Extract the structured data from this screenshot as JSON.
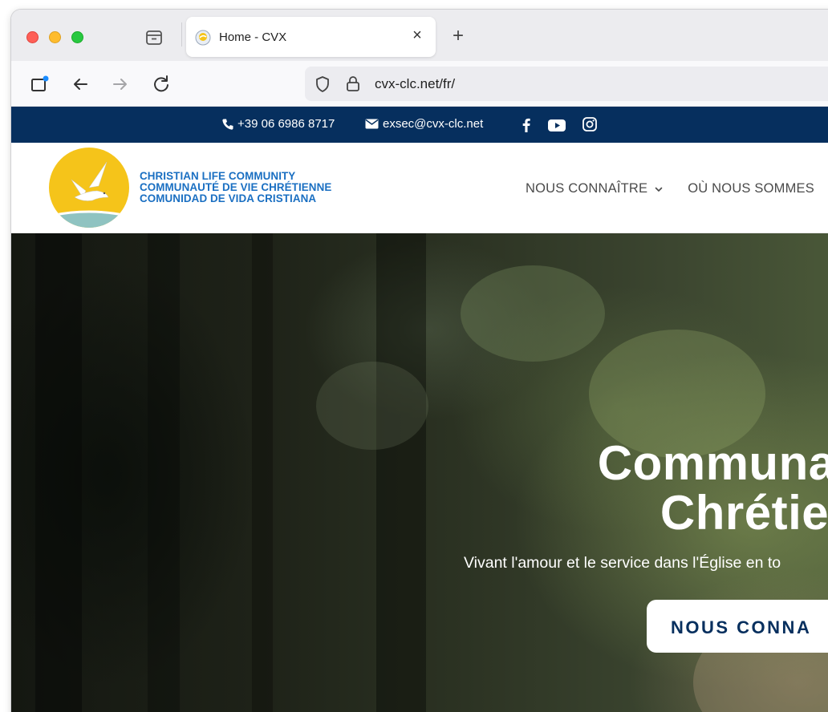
{
  "browser": {
    "tab": {
      "title": "Home - CVX",
      "close_glyph": "×"
    },
    "new_tab_glyph": "+",
    "url": "cvx-clc.net/fr/"
  },
  "topbar": {
    "phone": "+39 06 6986 8717",
    "email": "exsec@cvx-clc.net",
    "social_icons": [
      "facebook-icon",
      "youtube-icon",
      "instagram-icon"
    ]
  },
  "header": {
    "brand_lines": [
      "CHRISTIAN LIFE COMMUNITY",
      "COMMUNAUTÉ DE VIE CHRÉTIENNE",
      "COMUNIDAD DE VIDA CRISTIANA"
    ],
    "menu": [
      {
        "label": "NOUS CONNAÎTRE"
      },
      {
        "label": "OÙ NOUS SOMMES"
      }
    ]
  },
  "hero": {
    "title_line1": "Communaut",
    "title_line2": "Chrétie",
    "subtitle": "Vivant l'amour et le service dans l'Église en to",
    "button_label": "NOUS CONNA"
  },
  "colors": {
    "topbar": "#062f5e",
    "brand_text": "#1a6fc2",
    "logo_yellow": "#f5c41a",
    "logo_wave": "#8fc3c1"
  }
}
